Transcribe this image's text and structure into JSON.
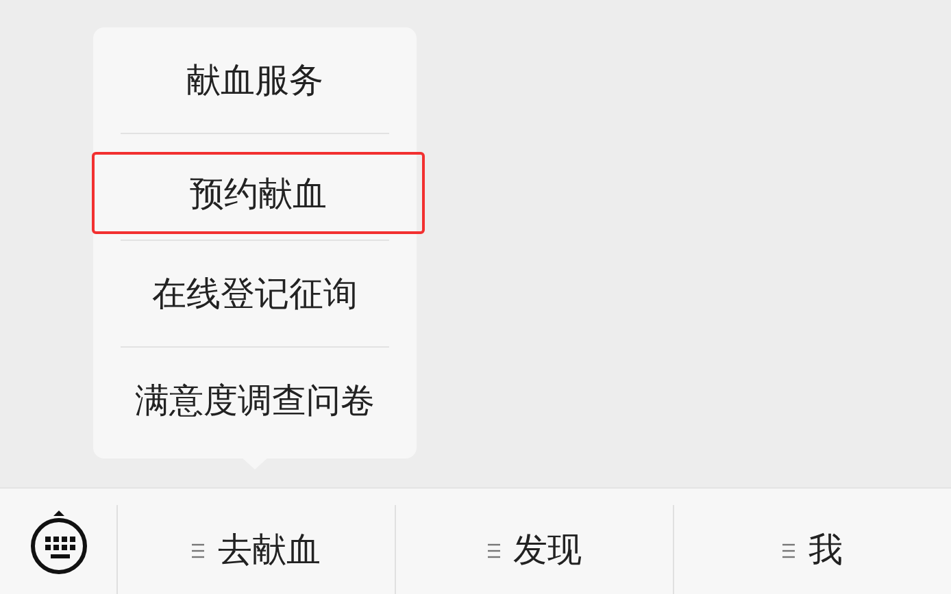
{
  "popup_menu": {
    "items": [
      {
        "label": "献血服务",
        "highlighted": false
      },
      {
        "label": "预约献血",
        "highlighted": true
      },
      {
        "label": "在线登记征询",
        "highlighted": false
      },
      {
        "label": "满意度调查问卷",
        "highlighted": false
      }
    ]
  },
  "bottom_menu": {
    "items": [
      {
        "label": "去献血"
      },
      {
        "label": "发现"
      },
      {
        "label": "我"
      }
    ]
  }
}
